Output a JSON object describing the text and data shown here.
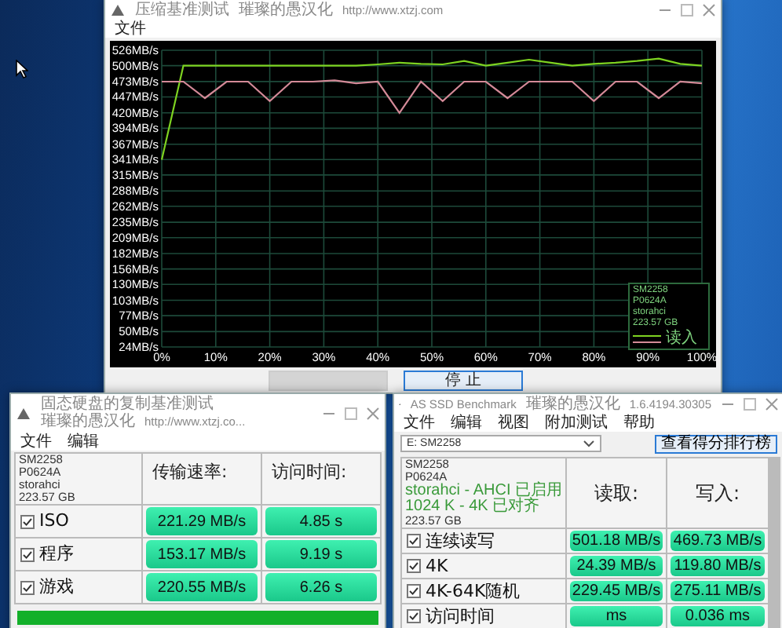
{
  "chart_window": {
    "title_parts": [
      {
        "text": "压缩基准测试",
        "kind": "cjk"
      },
      {
        "text": "璀璨的愚汉化",
        "kind": "cjk"
      },
      {
        "text": "http://www.xtzj.com",
        "kind": "latin"
      }
    ],
    "menu": [
      "文件"
    ],
    "chart_data": {
      "type": "line",
      "x": [
        0,
        4,
        8,
        12,
        16,
        20,
        24,
        28,
        32,
        36,
        40,
        44,
        48,
        52,
        56,
        60,
        64,
        68,
        72,
        76,
        80,
        84,
        88,
        92,
        96,
        100
      ],
      "grid": true,
      "series": [
        {
          "color": "#7ed321",
          "values": [
            341,
            500,
            500,
            500,
            500,
            500,
            500,
            500,
            500,
            500,
            502,
            505,
            503,
            502,
            508,
            500,
            505,
            510,
            505,
            500,
            503,
            505,
            508,
            512,
            503,
            500
          ]
        },
        {
          "color": "#d48a98",
          "values": [
            473,
            473,
            445,
            473,
            473,
            440,
            473,
            473,
            475,
            470,
            473,
            420,
            473,
            440,
            473,
            473,
            445,
            473,
            473,
            473,
            440,
            473,
            473,
            445,
            473,
            470
          ]
        }
      ],
      "xlim": [
        0,
        100
      ],
      "ylim": [
        24,
        526
      ],
      "xticks": [
        {
          "value": 0,
          "label": "0%"
        },
        {
          "value": 10,
          "label": "10%"
        },
        {
          "value": 20,
          "label": "20%"
        },
        {
          "value": 30,
          "label": "30%"
        },
        {
          "value": 40,
          "label": "40%"
        },
        {
          "value": 50,
          "label": "50%"
        },
        {
          "value": 60,
          "label": "60%"
        },
        {
          "value": 70,
          "label": "70%"
        },
        {
          "value": 80,
          "label": "80%"
        },
        {
          "value": 90,
          "label": "90%"
        },
        {
          "value": 100,
          "label": "100%"
        }
      ],
      "yticks": [
        {
          "value": 526,
          "label": "526MB/s"
        },
        {
          "value": 500,
          "label": "500MB/s"
        },
        {
          "value": 473,
          "label": "473MB/s"
        },
        {
          "value": 447,
          "label": "447MB/s"
        },
        {
          "value": 420,
          "label": "420MB/s"
        },
        {
          "value": 394,
          "label": "394MB/s"
        },
        {
          "value": 367,
          "label": "367MB/s"
        },
        {
          "value": 341,
          "label": "341MB/s"
        },
        {
          "value": 315,
          "label": "315MB/s"
        },
        {
          "value": 288,
          "label": "288MB/s"
        },
        {
          "value": 262,
          "label": "262MB/s"
        },
        {
          "value": 235,
          "label": "235MB/s"
        },
        {
          "value": 209,
          "label": "209MB/s"
        },
        {
          "value": 182,
          "label": "182MB/s"
        },
        {
          "value": 156,
          "label": "156MB/s"
        },
        {
          "value": 130,
          "label": "130MB/s"
        },
        {
          "value": 103,
          "label": "103MB/s"
        },
        {
          "value": 77,
          "label": "77MB/s"
        },
        {
          "value": 50,
          "label": "50MB/s"
        },
        {
          "value": 24,
          "label": "24MB/s"
        }
      ]
    },
    "legend": {
      "lines": [
        "SM2258",
        "P0624A",
        "storahci",
        "223.57 GB"
      ],
      "label": "读入"
    },
    "buttons": [
      {
        "disabled": true
      },
      {
        "label": "停 止",
        "disabled": false
      }
    ]
  },
  "copy_window": {
    "title_parts": [
      {
        "text": "固态硬盘的复制基准测试",
        "kind": "cjk"
      },
      {
        "text": "璀璨的愚汉化",
        "kind": "cjk"
      },
      {
        "text": "http://www.xtzj.co...",
        "kind": "latin"
      }
    ],
    "menu": [
      "文件",
      "编辑"
    ],
    "drive_info": [
      "SM2258",
      "P0624A",
      "storahci",
      "223.57 GB"
    ],
    "columns": [
      "传输速率:",
      "访问时间:"
    ],
    "rows": [
      {
        "label": "ISO",
        "checked": true,
        "values": [
          "221.29 MB/s",
          "4.85 s"
        ]
      },
      {
        "label": "程序",
        "checked": true,
        "values": [
          "153.17 MB/s",
          "9.19 s"
        ]
      },
      {
        "label": "游戏",
        "checked": true,
        "values": [
          "220.55 MB/s",
          "6.26 s"
        ]
      }
    ],
    "progress": {
      "level": 1
    }
  },
  "asssd_window": {
    "title_parts": [
      {
        "text": "AS SSD Benchmark",
        "kind": "latin"
      },
      {
        "text": "璀璨的愚汉化",
        "kind": "cjk"
      },
      {
        "text": "1.6.4194.30305",
        "kind": "latin"
      }
    ],
    "menu": [
      "文件",
      "编辑",
      "视图",
      "附加测试",
      "帮助"
    ],
    "drive_select": "E: SM2258",
    "ranking_button": "查看得分排行榜",
    "drive_info": [
      {
        "text": "SM2258",
        "kind": "plain"
      },
      {
        "text": "P0624A",
        "kind": "plain"
      },
      {
        "text": "storahci - AHCI 已启用",
        "kind": "ok"
      },
      {
        "text": "1024 K - 4K 已对齐",
        "kind": "ok"
      },
      {
        "text": "223.57 GB",
        "kind": "plain"
      }
    ],
    "columns": [
      "读取:",
      "写入:"
    ],
    "rows": [
      {
        "label": "连续读写",
        "checked": true,
        "values": [
          "501.18 MB/s",
          "469.73 MB/s"
        ]
      },
      {
        "label": "4K",
        "checked": true,
        "values": [
          "24.39 MB/s",
          "119.80 MB/s"
        ]
      },
      {
        "label": "4K-64K随机",
        "checked": true,
        "values": [
          "229.45 MB/s",
          "275.11 MB/s"
        ]
      },
      {
        "label": "访问时间",
        "checked": true,
        "values": [
          "ms",
          "0.036 ms"
        ]
      }
    ]
  }
}
